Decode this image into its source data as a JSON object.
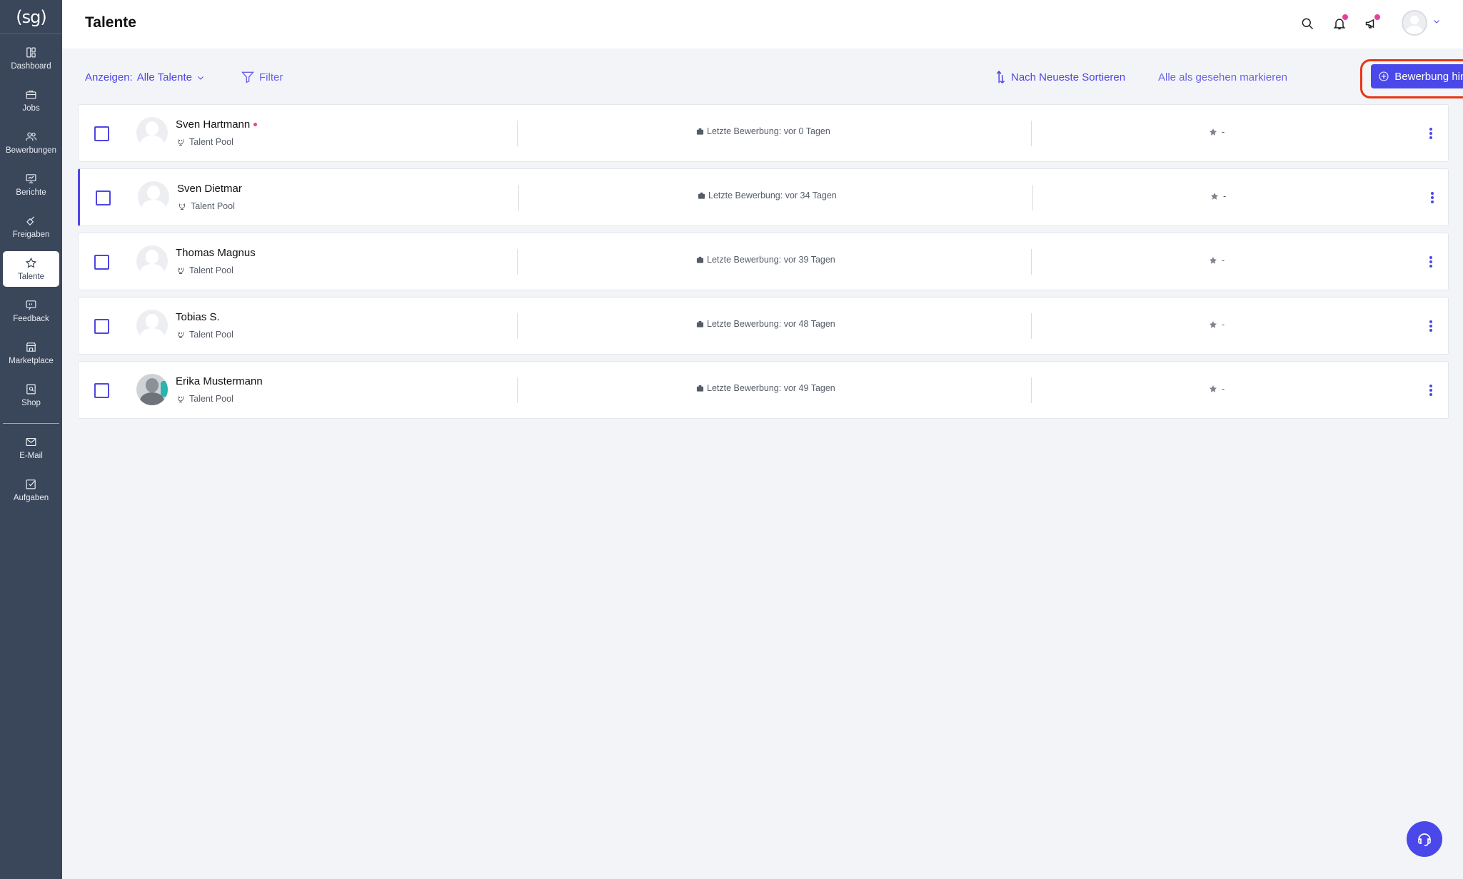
{
  "app": {
    "logo_text": "(sg)",
    "page_title": "Talente"
  },
  "sidebar": {
    "items": [
      {
        "label": "Dashboard",
        "icon": "dashboard-icon",
        "active": false
      },
      {
        "label": "Jobs",
        "icon": "briefcase-icon",
        "active": false
      },
      {
        "label": "Bewerbungen",
        "icon": "users-icon",
        "active": false
      },
      {
        "label": "Berichte",
        "icon": "presentation-chart-icon",
        "active": false
      },
      {
        "label": "Freigaben",
        "icon": "hand-pointer-icon",
        "active": false
      },
      {
        "label": "Talente",
        "icon": "star-icon",
        "active": true
      },
      {
        "label": "Feedback",
        "icon": "quote-bubble-icon",
        "active": false
      },
      {
        "label": "Marketplace",
        "icon": "store-icon",
        "active": false
      },
      {
        "label": "Shop",
        "icon": "search-document-icon",
        "active": false
      }
    ],
    "bottom_items": [
      {
        "label": "E-Mail",
        "icon": "mail-icon"
      },
      {
        "label": "Aufgaben",
        "icon": "checkbox-icon"
      }
    ]
  },
  "toolbar": {
    "show_label": "Anzeigen:",
    "show_value": "Alle Talente",
    "filter_label": "Filter",
    "sort_label": "Nach Neueste Sortieren",
    "mark_seen_label": "Alle als gesehen markieren",
    "add_label": "Bewerbung hinzufügen"
  },
  "talents": [
    {
      "name": "Sven Hartmann",
      "is_new": true,
      "pool": "Talent Pool",
      "last": "Letzte Bewerbung: vor 0 Tagen",
      "rating": "-",
      "photo": false,
      "selected": false
    },
    {
      "name": "Sven Dietmar",
      "is_new": false,
      "pool": "Talent Pool",
      "last": "Letzte Bewerbung: vor 34 Tagen",
      "rating": "-",
      "photo": false,
      "selected": true
    },
    {
      "name": "Thomas Magnus",
      "is_new": false,
      "pool": "Talent Pool",
      "last": "Letzte Bewerbung: vor 39 Tagen",
      "rating": "-",
      "photo": false,
      "selected": false
    },
    {
      "name": "Tobias S.",
      "is_new": false,
      "pool": "Talent Pool",
      "last": "Letzte Bewerbung: vor 48 Tagen",
      "rating": "-",
      "photo": false,
      "selected": false
    },
    {
      "name": "Erika Mustermann",
      "is_new": false,
      "pool": "Talent Pool",
      "last": "Letzte Bewerbung: vor 49 Tagen",
      "rating": "-",
      "photo": true,
      "selected": false
    }
  ],
  "colors": {
    "accent": "#4a48e8",
    "sidebar_bg": "#3a465a",
    "highlight": "#e83414",
    "notification_dot": "#e83f9e"
  }
}
